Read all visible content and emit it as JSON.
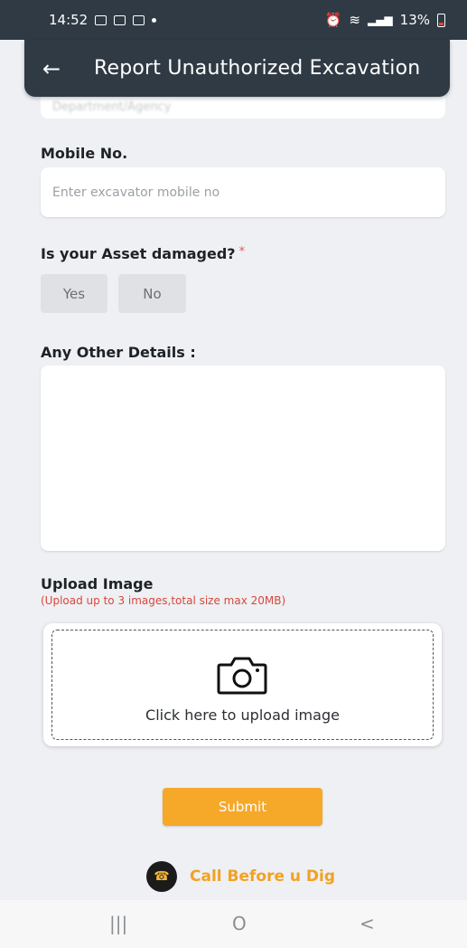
{
  "status_bar": {
    "time": "14:52",
    "battery": "13%"
  },
  "app_bar": {
    "back_icon": "arrow-left-icon",
    "title": "Report Unauthorized Excavation"
  },
  "form": {
    "partial_field_placeholder": "Department/Agency",
    "mobile": {
      "label": "Mobile No.",
      "placeholder": "Enter excavator mobile no"
    },
    "asset_damaged": {
      "label": "Is your Asset damaged?",
      "required_mark": "*",
      "yes_label": "Yes",
      "no_label": "No"
    },
    "other_details": {
      "label": "Any Other Details :"
    },
    "upload": {
      "label": "Upload Image",
      "hint": "(Upload up to 3 images,total size max 20MB)",
      "button_text": "Click here to upload image",
      "icon": "camera-icon"
    },
    "submit_label": "Submit"
  },
  "brand": {
    "text": "Call Before u Dig"
  },
  "navbar": {
    "recent_icon": "|||",
    "home_icon": "O",
    "back_icon": "<"
  },
  "colors": {
    "primary_dark": "#2f3a44",
    "accent": "#f6a829",
    "brand_text": "#f2a123",
    "required": "#e65a5a"
  }
}
